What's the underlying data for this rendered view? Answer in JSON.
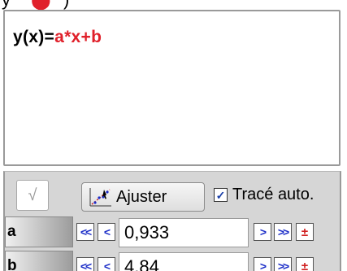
{
  "equation": {
    "lhs": "y(x)=",
    "rhs": "a*x+b"
  },
  "toolbar": {
    "check_glyph": "√",
    "fit_label": "Ajuster",
    "autotrace_label": "Tracé auto.",
    "autotrace_checked": true
  },
  "params": [
    {
      "name": "a",
      "value": "0,933",
      "dec_fast": "<<",
      "dec": "<",
      "inc": ">",
      "inc_fast": ">>",
      "plusminus": "±"
    },
    {
      "name": "b",
      "value": "4,84",
      "dec_fast": "<<",
      "dec": "<",
      "inc": ">",
      "inc_fast": ">>",
      "plusminus": "±"
    }
  ],
  "colors": {
    "equation_rhs": "#e0202a",
    "arrow_blue": "#1c2ec8",
    "plusminus_red": "#d02020",
    "panel_bg": "#d6d6d6"
  },
  "icons": {
    "check": "check-icon",
    "fit": "fit-curve-icon",
    "checkbox": "checkmark-icon"
  }
}
